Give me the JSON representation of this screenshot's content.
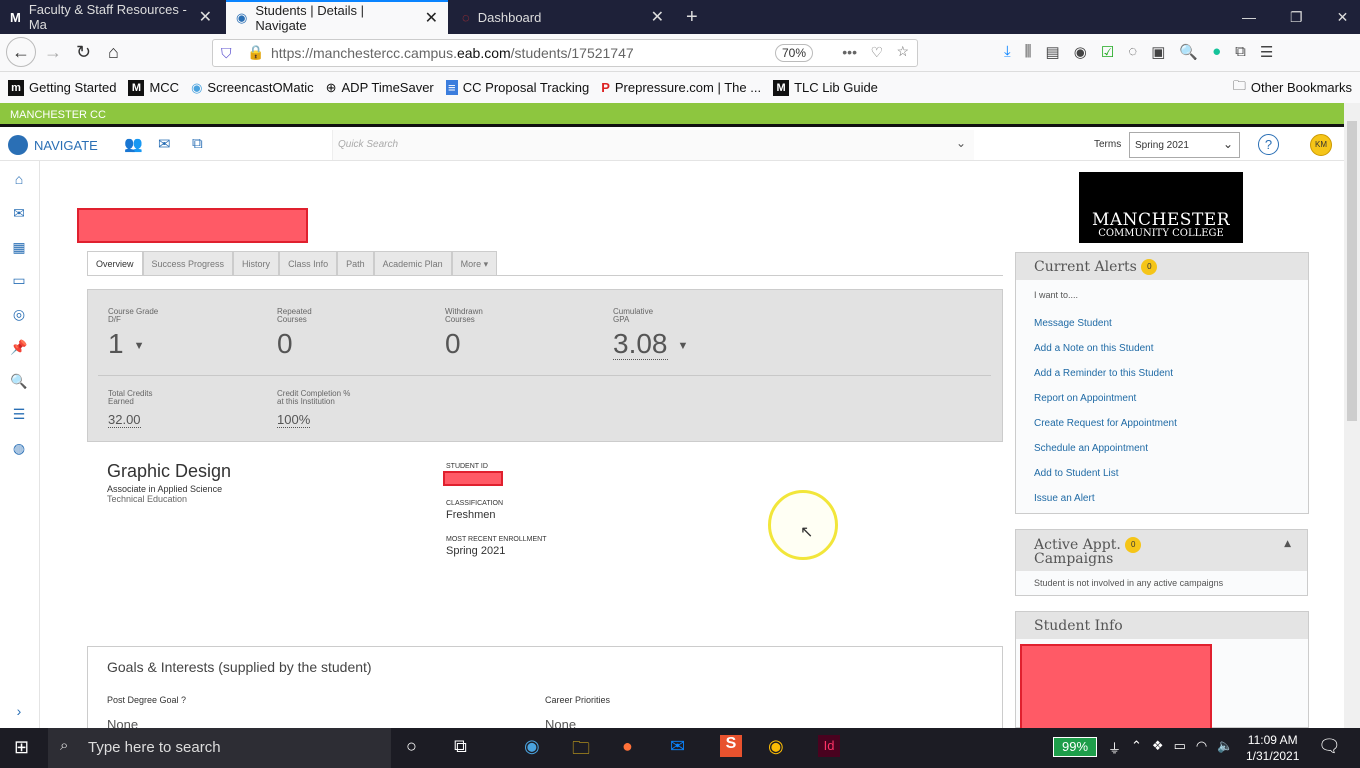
{
  "browser": {
    "tabs": [
      {
        "label": "Faculty & Staff Resources - Ma",
        "icon": "M"
      },
      {
        "label": "Students | Details | Navigate",
        "active": true
      },
      {
        "label": "Dashboard"
      }
    ],
    "url_prefix": "https://manchestercc.campus.",
    "url_domain": "eab.com",
    "url_path": "/students/17521747",
    "zoom": "70%",
    "bookmarks": [
      {
        "label": "Getting Started",
        "icon": "m"
      },
      {
        "label": "MCC",
        "icon": "M"
      },
      {
        "label": "ScreencastOMatic",
        "icon": "◉"
      },
      {
        "label": "ADP TimeSaver",
        "icon": "⊕"
      },
      {
        "label": "CC Proposal Tracking",
        "icon": "≡"
      },
      {
        "label": "Prepressure.com | The ...",
        "icon": "P"
      },
      {
        "label": "TLC Lib Guide",
        "icon": "M"
      }
    ],
    "other_bookmarks": "Other Bookmarks"
  },
  "app": {
    "institution": "MANCHESTER CC",
    "brand": "NAVIGATE",
    "search_placeholder": "Quick Search",
    "terms_label": "Terms",
    "term_value": "Spring 2021",
    "user_initials": "KM",
    "accent": "#8dc63f"
  },
  "student": {
    "tabs": [
      "Overview",
      "Success Progress",
      "History",
      "Class Info",
      "Path",
      "Academic Plan",
      "More ▾"
    ],
    "stats": [
      {
        "l1": "Course Grade",
        "l2": "D/F",
        "value": "1",
        "dropdown": true
      },
      {
        "l1": "Repeated",
        "l2": "Courses",
        "value": "0"
      },
      {
        "l1": "Withdrawn",
        "l2": "Courses",
        "value": "0"
      },
      {
        "l1": "Cumulative",
        "l2": "GPA",
        "value": "3.08",
        "dropdown": true
      }
    ],
    "stats2": [
      {
        "l1": "Total Credits",
        "l2": "Earned",
        "value": "32.00"
      },
      {
        "l1": "Credit Completion %",
        "l2": "at this Institution",
        "value": "100%"
      }
    ],
    "major": "Graphic Design",
    "degree": "Associate in Applied Science",
    "division": "Technical Education",
    "id_label": "STUDENT ID",
    "class_label": "CLASSIFICATION",
    "classification": "Freshmen",
    "enroll_label": "MOST RECENT ENROLLMENT",
    "enrollment": "Spring 2021",
    "goals_title": "Goals & Interests (supplied by the student)",
    "goal_label": "Post Degree Goal ?",
    "goal_value": "None",
    "career_label": "Career Priorities",
    "career_value": "None"
  },
  "right": {
    "logo_line1": "MANCHESTER",
    "logo_line2": "COMMUNITY COLLEGE",
    "alerts_title": "Current Alerts",
    "alerts_count": "0",
    "i_want": "I want to....",
    "actions": [
      "Message Student",
      "Add a Note on this Student",
      "Add a Reminder to this Student",
      "Report on Appointment",
      "Create Request for Appointment",
      "Schedule an Appointment",
      "Add to Student List",
      "Issue an Alert"
    ],
    "campaigns_title1": "Active Appt.",
    "campaigns_title2": "Campaigns",
    "campaigns_count": "0",
    "campaigns_text": "Student is not involved in any active campaigns",
    "info_title": "Student Info"
  },
  "taskbar": {
    "search": "Type here to search",
    "battery": "99%",
    "time": "11:09 AM",
    "date": "1/31/2021"
  }
}
